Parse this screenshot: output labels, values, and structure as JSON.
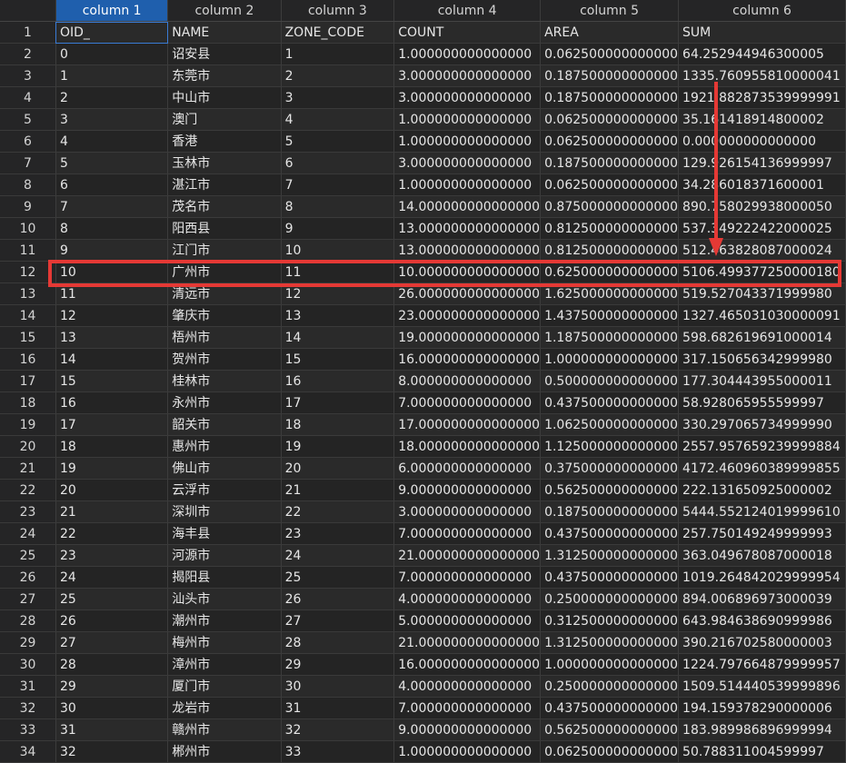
{
  "columns": [
    "column 1",
    "column 2",
    "column 3",
    "column 4",
    "column 5",
    "column 6"
  ],
  "rows": [
    [
      "1",
      "OID_",
      "NAME",
      "ZONE_CODE",
      "COUNT",
      "AREA",
      "SUM"
    ],
    [
      "2",
      "0",
      "诏安县",
      "1",
      "1.000000000000000",
      "0.062500000000000",
      "64.252944946300005"
    ],
    [
      "3",
      "1",
      "东莞市",
      "2",
      "3.000000000000000",
      "0.187500000000000",
      "1335.760955810000041"
    ],
    [
      "4",
      "2",
      "中山市",
      "3",
      "3.000000000000000",
      "0.187500000000000",
      "1921.882873539999991"
    ],
    [
      "5",
      "3",
      "澳门",
      "4",
      "1.000000000000000",
      "0.062500000000000",
      "35.161418914800002"
    ],
    [
      "6",
      "4",
      "香港",
      "5",
      "1.000000000000000",
      "0.062500000000000",
      "0.000000000000000"
    ],
    [
      "7",
      "5",
      "玉林市",
      "6",
      "3.000000000000000",
      "0.187500000000000",
      "129.926154136999997"
    ],
    [
      "8",
      "6",
      "湛江市",
      "7",
      "1.000000000000000",
      "0.062500000000000",
      "34.286018371600001"
    ],
    [
      "9",
      "7",
      "茂名市",
      "8",
      "14.000000000000000",
      "0.875000000000000",
      "890.758029938000050"
    ],
    [
      "10",
      "8",
      "阳西县",
      "9",
      "13.000000000000000",
      "0.812500000000000",
      "537.349222422000025"
    ],
    [
      "11",
      "9",
      "江门市",
      "10",
      "13.000000000000000",
      "0.812500000000000",
      "512.463828087000024"
    ],
    [
      "12",
      "10",
      "广州市",
      "11",
      "10.000000000000000",
      "0.625000000000000",
      "5106.499377250000180"
    ],
    [
      "13",
      "11",
      "清远市",
      "12",
      "26.000000000000000",
      "1.625000000000000",
      "519.527043371999980"
    ],
    [
      "14",
      "12",
      "肇庆市",
      "13",
      "23.000000000000000",
      "1.437500000000000",
      "1327.465031030000091"
    ],
    [
      "15",
      "13",
      "梧州市",
      "14",
      "19.000000000000000",
      "1.187500000000000",
      "598.682619691000014"
    ],
    [
      "16",
      "14",
      "贺州市",
      "15",
      "16.000000000000000",
      "1.000000000000000",
      "317.150656342999980"
    ],
    [
      "17",
      "15",
      "桂林市",
      "16",
      "8.000000000000000",
      "0.500000000000000",
      "177.304443955000011"
    ],
    [
      "18",
      "16",
      "永州市",
      "17",
      "7.000000000000000",
      "0.437500000000000",
      "58.928065955599997"
    ],
    [
      "19",
      "17",
      "韶关市",
      "18",
      "17.000000000000000",
      "1.062500000000000",
      "330.297065734999990"
    ],
    [
      "20",
      "18",
      "惠州市",
      "19",
      "18.000000000000000",
      "1.125000000000000",
      "2557.957659239999884"
    ],
    [
      "21",
      "19",
      "佛山市",
      "20",
      "6.000000000000000",
      "0.375000000000000",
      "4172.460960389999855"
    ],
    [
      "22",
      "20",
      "云浮市",
      "21",
      "9.000000000000000",
      "0.562500000000000",
      "222.131650925000002"
    ],
    [
      "23",
      "21",
      "深圳市",
      "22",
      "3.000000000000000",
      "0.187500000000000",
      "5444.552124019999610"
    ],
    [
      "24",
      "22",
      "海丰县",
      "23",
      "7.000000000000000",
      "0.437500000000000",
      "257.750149249999993"
    ],
    [
      "25",
      "23",
      "河源市",
      "24",
      "21.000000000000000",
      "1.312500000000000",
      "363.049678087000018"
    ],
    [
      "26",
      "24",
      "揭阳县",
      "25",
      "7.000000000000000",
      "0.437500000000000",
      "1019.264842029999954"
    ],
    [
      "27",
      "25",
      "汕头市",
      "26",
      "4.000000000000000",
      "0.250000000000000",
      "894.006896973000039"
    ],
    [
      "28",
      "26",
      "潮州市",
      "27",
      "5.000000000000000",
      "0.312500000000000",
      "643.984638690999986"
    ],
    [
      "29",
      "27",
      "梅州市",
      "28",
      "21.000000000000000",
      "1.312500000000000",
      "390.216702580000003"
    ],
    [
      "30",
      "28",
      "漳州市",
      "29",
      "16.000000000000000",
      "1.000000000000000",
      "1224.797664879999957"
    ],
    [
      "31",
      "29",
      "厦门市",
      "30",
      "4.000000000000000",
      "0.250000000000000",
      "1509.514440539999896"
    ],
    [
      "32",
      "30",
      "龙岩市",
      "31",
      "7.000000000000000",
      "0.437500000000000",
      "194.159378290000006"
    ],
    [
      "33",
      "31",
      "赣州市",
      "32",
      "9.000000000000000",
      "0.562500000000000",
      "183.989986896999994"
    ],
    [
      "34",
      "32",
      "郴州市",
      "33",
      "1.000000000000000",
      "0.062500000000000",
      "50.788311004599997"
    ]
  ],
  "highlight": {
    "row_label": "12",
    "color": "#e53935"
  },
  "colors": {
    "background": "#1e1e1e",
    "header_active": "#1f5fad",
    "annotation": "#e53935"
  }
}
